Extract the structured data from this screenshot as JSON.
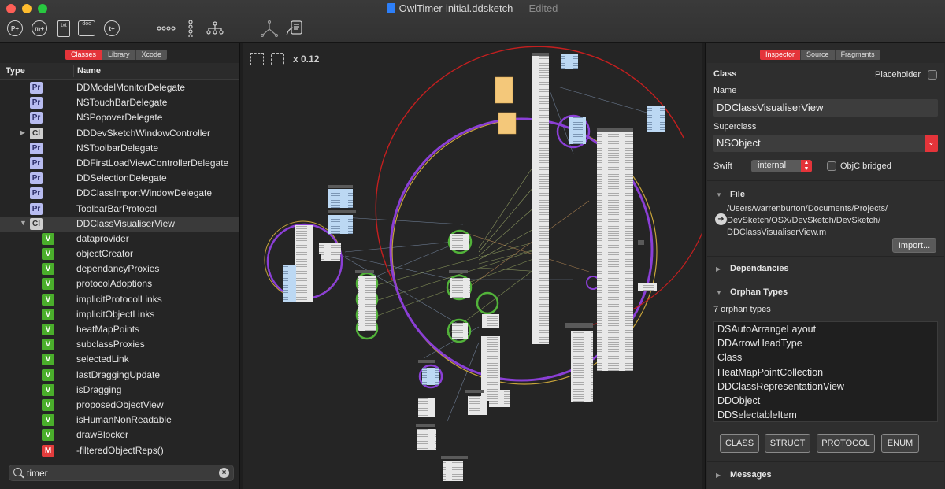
{
  "window": {
    "title": "OwlTimer-initial.ddsketch",
    "edited": "— Edited"
  },
  "toolbar": {
    "buttons": [
      {
        "name": "add-protocol",
        "glyph": "P+"
      },
      {
        "name": "add-method",
        "glyph": "m+"
      },
      {
        "name": "add-file",
        "glyph": "txt"
      },
      {
        "name": "add-doc",
        "glyph": "doc"
      },
      {
        "name": "add-type",
        "glyph": "t+"
      }
    ]
  },
  "left": {
    "tabs": [
      "Classes",
      "Library",
      "Xcode"
    ],
    "active_tab": "Classes",
    "columns": {
      "type": "Type",
      "name": "Name"
    },
    "rows": [
      {
        "kind": "Pr",
        "name": "DDModelMonitorDelegate"
      },
      {
        "kind": "Pr",
        "name": "NSTouchBarDelegate"
      },
      {
        "kind": "Pr",
        "name": "NSPopoverDelegate"
      },
      {
        "kind": "Cl",
        "name": "DDDevSketchWindowController",
        "disclosure": "▶"
      },
      {
        "kind": "Pr",
        "name": "NSToolbarDelegate"
      },
      {
        "kind": "Pr",
        "name": "DDFirstLoadViewControllerDelegate"
      },
      {
        "kind": "Pr",
        "name": "DDSelectionDelegate"
      },
      {
        "kind": "Pr",
        "name": "DDClassImportWindowDelegate"
      },
      {
        "kind": "Pr",
        "name": "ToolbarBarProtocol"
      },
      {
        "kind": "Cl",
        "name": "DDClassVisualiserView",
        "disclosure": "▼",
        "selected": true
      },
      {
        "kind": "V",
        "name": "dataprovider"
      },
      {
        "kind": "V",
        "name": "objectCreator"
      },
      {
        "kind": "V",
        "name": "dependancyProxies"
      },
      {
        "kind": "V",
        "name": "protocolAdoptions"
      },
      {
        "kind": "V",
        "name": "implicitProtocolLinks"
      },
      {
        "kind": "V",
        "name": "implicitObjectLinks"
      },
      {
        "kind": "V",
        "name": "heatMapPoints"
      },
      {
        "kind": "V",
        "name": "subclassProxies"
      },
      {
        "kind": "V",
        "name": "selectedLink"
      },
      {
        "kind": "V",
        "name": "lastDraggingUpdate"
      },
      {
        "kind": "V",
        "name": "isDragging"
      },
      {
        "kind": "V",
        "name": "proposedObjectView"
      },
      {
        "kind": "V",
        "name": "isHumanNonReadable"
      },
      {
        "kind": "V",
        "name": "drawBlocker"
      },
      {
        "kind": "M",
        "name": "-filteredObjectReps()"
      }
    ],
    "search": {
      "value": "timer"
    }
  },
  "canvas": {
    "zoom_label": "x 0.12"
  },
  "inspector": {
    "tabs": [
      "Inspector",
      "Source",
      "Fragments"
    ],
    "active_tab": "Inspector",
    "class_heading": "Class",
    "placeholder_label": "Placeholder",
    "placeholder_checked": false,
    "name_label": "Name",
    "name_value": "DDClassVisualiserView",
    "superclass_label": "Superclass",
    "superclass_value": "NSObject",
    "swift_label": "Swift",
    "swift_access": "internal",
    "objc_label": "ObjC bridged",
    "objc_checked": false,
    "file_section": "File",
    "file_path_lines": [
      "/Users/warrenburton/Documents/Projects/",
      "DevSketch/OSX/DevSketch/DevSketch/",
      "DDClassVisualiserView.m"
    ],
    "import_button": "Import...",
    "dependancies_section": "Dependancies",
    "orphan_section": "Orphan Types",
    "orphan_count": "7 orphan types",
    "orphans": [
      "DSAutoArrangeLayout",
      "DDArrowHeadType",
      "Class",
      "HeatMapPointCollection",
      "DDClassRepresentationView",
      "DDObject",
      "DDSelectableItem"
    ],
    "kind_buttons": [
      "CLASS",
      "STRUCT",
      "PROTOCOL",
      "ENUM"
    ],
    "messages_section": "Messages"
  },
  "colors": {
    "accent": "#e4343a",
    "protocol_badge": "#b8bcf0",
    "var_badge": "#4aae2b",
    "method_badge": "#e33c3c",
    "graph_purple": "#8b3fd6",
    "graph_green": "#52b33a",
    "graph_red": "#c41f1f"
  }
}
